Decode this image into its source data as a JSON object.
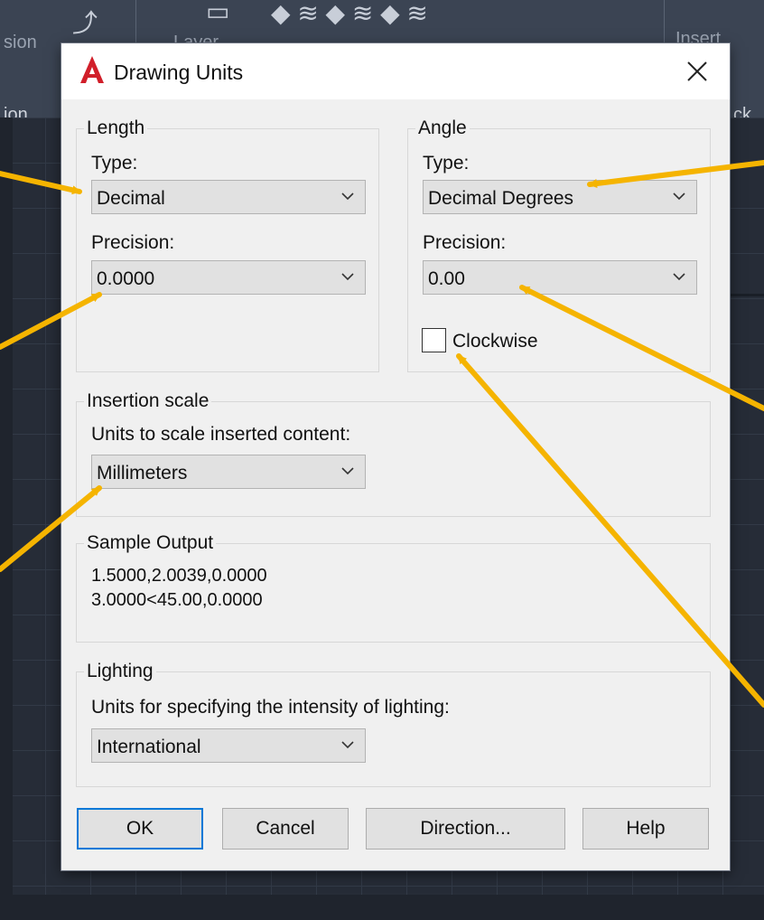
{
  "background": {
    "ribbon_labels": [
      "sion",
      "Layer",
      "Insert",
      "ion",
      "ck"
    ]
  },
  "dialog": {
    "title": "Drawing Units",
    "close_icon": "close-icon",
    "length": {
      "group_title": "Length",
      "type_label": "Type:",
      "type_value": "Decimal",
      "precision_label": "Precision:",
      "precision_value": "0.0000"
    },
    "angle": {
      "group_title": "Angle",
      "type_label": "Type:",
      "type_value": "Decimal Degrees",
      "precision_label": "Precision:",
      "precision_value": "0.00",
      "clockwise_label": "Clockwise",
      "clockwise_checked": false
    },
    "insertion_scale": {
      "group_title": "Insertion scale",
      "units_label": "Units to scale inserted content:",
      "units_value": "Millimeters"
    },
    "sample_output": {
      "group_title": "Sample Output",
      "line1": "1.5000,2.0039,0.0000",
      "line2": "3.0000<45.00,0.0000"
    },
    "lighting": {
      "group_title": "Lighting",
      "units_label": "Units for specifying the intensity of lighting:",
      "units_value": "International"
    },
    "buttons": {
      "ok": "OK",
      "cancel": "Cancel",
      "direction": "Direction...",
      "help": "Help"
    }
  },
  "colors": {
    "accent_border": "#0078d7",
    "annotation_arrow": "#f5b400",
    "app_icon_red": "#d11f2a"
  }
}
